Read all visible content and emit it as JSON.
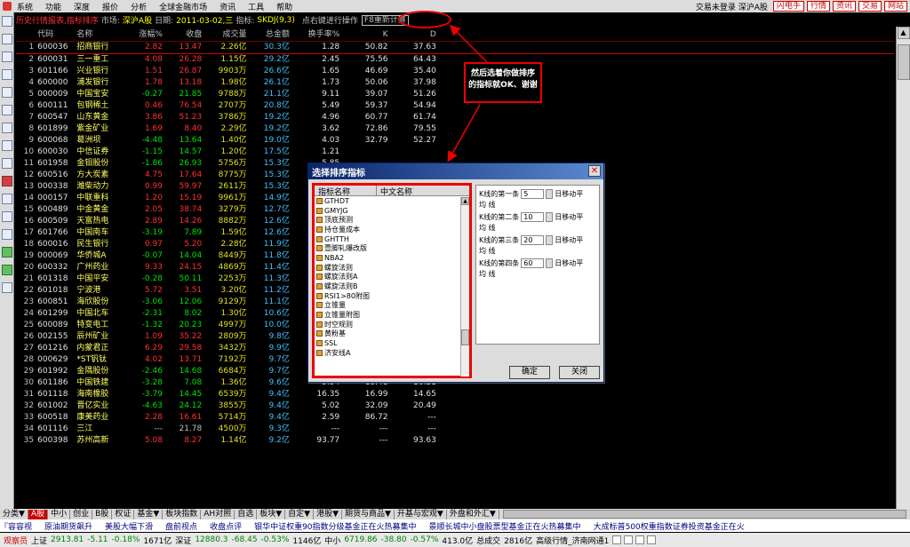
{
  "menu": {
    "items": [
      "系统",
      "功能",
      "深度",
      "报价",
      "分析",
      "全球金融市场",
      "资讯",
      "工具",
      "帮助"
    ],
    "login_status": "交易未登录 深沪A股",
    "buttons": [
      "闪电手",
      "行情",
      "资讯",
      "交易",
      "网站"
    ]
  },
  "titlebar": {
    "title": "历史行情报表,指标排序",
    "market_label": "市场:",
    "market_value": "深沪A股",
    "date_label": "日期:",
    "date_value": "2011-03-02,三",
    "indicator_label": "指标:",
    "indicator_value": "SKDJ(9,3)",
    "hint": "点右键进行操作",
    "recalc_button": "F8重新计算"
  },
  "table": {
    "columns": [
      "",
      "代码",
      "名称",
      "涨幅%",
      "收盘",
      "成交量",
      "总金额",
      "换手率%",
      "K",
      "D"
    ],
    "rows": [
      {
        "i": "1",
        "code": "600036",
        "name": "招商银行",
        "chg": "2.82",
        "close": "13.47",
        "vol": "2.26亿",
        "amt": "30.3亿",
        "turn": "1.28",
        "k": "50.82",
        "d": "37.63"
      },
      {
        "i": "2",
        "code": "600031",
        "name": "三一重工",
        "chg": "4.08",
        "close": "26.28",
        "vol": "1.15亿",
        "amt": "29.2亿",
        "turn": "2.45",
        "k": "75.56",
        "d": "64.43"
      },
      {
        "i": "3",
        "code": "601166",
        "name": "兴业银行",
        "chg": "1.51",
        "close": "26.87",
        "vol": "9903万",
        "amt": "26.6亿",
        "turn": "1.65",
        "k": "46.69",
        "d": "35.40"
      },
      {
        "i": "4",
        "code": "600000",
        "name": "浦发银行",
        "chg": "1.78",
        "close": "13.18",
        "vol": "1.98亿",
        "amt": "26.1亿",
        "turn": "1.73",
        "k": "50.06",
        "d": "37.98"
      },
      {
        "i": "5",
        "code": "000009",
        "name": "中国宝安",
        "chg": "-0.27",
        "close": "21.85",
        "vol": "9788万",
        "amt": "21.1亿",
        "turn": "9.11",
        "k": "39.07",
        "d": "51.26"
      },
      {
        "i": "6",
        "code": "600111",
        "name": "包钢稀土",
        "chg": "0.46",
        "close": "76.54",
        "vol": "2707万",
        "amt": "20.8亿",
        "turn": "5.49",
        "k": "59.37",
        "d": "54.94"
      },
      {
        "i": "7",
        "code": "600547",
        "name": "山东黄金",
        "chg": "3.86",
        "close": "51.23",
        "vol": "3786万",
        "amt": "19.2亿",
        "turn": "4.96",
        "k": "60.77",
        "d": "61.74"
      },
      {
        "i": "8",
        "code": "601899",
        "name": "紫金矿业",
        "chg": "1.69",
        "close": "8.40",
        "vol": "2.29亿",
        "amt": "19.2亿",
        "turn": "3.62",
        "k": "72.86",
        "d": "79.55"
      },
      {
        "i": "9",
        "code": "600068",
        "name": "葛洲坝",
        "chg": "-4.48",
        "close": "13.64",
        "vol": "1.40亿",
        "amt": "19.0亿",
        "turn": "4.03",
        "k": "32.79",
        "d": "52.27"
      },
      {
        "i": "10",
        "code": "600030",
        "name": "中信证券",
        "chg": "-1.15",
        "close": "14.57",
        "vol": "1.20亿",
        "amt": "17.5亿",
        "turn": "1.21",
        "k": "",
        "d": ""
      },
      {
        "i": "11",
        "code": "601958",
        "name": "金钼股份",
        "chg": "-1.86",
        "close": "26.93",
        "vol": "5756万",
        "amt": "15.3亿",
        "turn": "5.85",
        "k": "",
        "d": ""
      },
      {
        "i": "12",
        "code": "600516",
        "name": "方大炭素",
        "chg": "4.75",
        "close": "17.64",
        "vol": "8775万",
        "amt": "15.3亿",
        "turn": "14.2",
        "k": "",
        "d": ""
      },
      {
        "i": "13",
        "code": "000338",
        "name": "潍柴动力",
        "chg": "0.99",
        "close": "59.97",
        "vol": "2611万",
        "amt": "15.3亿",
        "turn": "3.9",
        "k": "",
        "d": ""
      },
      {
        "i": "14",
        "code": "000157",
        "name": "中联重科",
        "chg": "1.20",
        "close": "15.19",
        "vol": "9961万",
        "amt": "14.9亿",
        "turn": "2.0",
        "k": "",
        "d": ""
      },
      {
        "i": "15",
        "code": "600489",
        "name": "中金黄金",
        "chg": "2.05",
        "close": "38.74",
        "vol": "3279万",
        "amt": "12.7亿",
        "turn": "2.3",
        "k": "",
        "d": ""
      },
      {
        "i": "16",
        "code": "600509",
        "name": "天富热电",
        "chg": "2.89",
        "close": "14.26",
        "vol": "8882万",
        "amt": "12.6亿",
        "turn": "13.5",
        "k": "",
        "d": ""
      },
      {
        "i": "17",
        "code": "601766",
        "name": "中国南车",
        "chg": "-3.19",
        "close": "7.89",
        "vol": "1.59亿",
        "amt": "12.6亿",
        "turn": "1.6",
        "k": "",
        "d": ""
      },
      {
        "i": "18",
        "code": "600016",
        "name": "民生银行",
        "chg": "0.97",
        "close": "5.20",
        "vol": "2.28亿",
        "amt": "11.9亿",
        "turn": "1.0",
        "k": "",
        "d": ""
      },
      {
        "i": "19",
        "code": "000069",
        "name": "华侨城A",
        "chg": "-0.07",
        "close": "14.04",
        "vol": "8449万",
        "amt": "11.8亿",
        "turn": "2.9",
        "k": "",
        "d": ""
      },
      {
        "i": "20",
        "code": "600332",
        "name": "广州药业",
        "chg": "9.33",
        "close": "24.15",
        "vol": "4869万",
        "amt": "11.4亿",
        "turn": "9.7",
        "k": "",
        "d": ""
      },
      {
        "i": "21",
        "code": "601318",
        "name": "中国平安",
        "chg": "-0.28",
        "close": "50.11",
        "vol": "2253万",
        "amt": "11.3亿",
        "turn": "0.4",
        "k": "",
        "d": ""
      },
      {
        "i": "22",
        "code": "601018",
        "name": "宁波港",
        "chg": "5.72",
        "close": "3.51",
        "vol": "3.20亿",
        "amt": "11.2亿",
        "turn": "10.2",
        "k": "",
        "d": ""
      },
      {
        "i": "23",
        "code": "600851",
        "name": "海欣股份",
        "chg": "-3.06",
        "close": "12.06",
        "vol": "9129万",
        "amt": "11.1亿",
        "turn": "12.5",
        "k": "",
        "d": ""
      },
      {
        "i": "24",
        "code": "601299",
        "name": "中国北车",
        "chg": "-2.31",
        "close": "8.02",
        "vol": "1.30亿",
        "amt": "10.6亿",
        "turn": "1.3",
        "k": "",
        "d": ""
      },
      {
        "i": "25",
        "code": "600089",
        "name": "特变电工",
        "chg": "-1.32",
        "close": "20.23",
        "vol": "4997万",
        "amt": "10.0亿",
        "turn": "2.2",
        "k": "",
        "d": ""
      },
      {
        "i": "26",
        "code": "002155",
        "name": "辰州矿业",
        "chg": "1.09",
        "close": "35.22",
        "vol": "2809万",
        "amt": "9.8亿",
        "turn": "8.7",
        "k": "",
        "d": ""
      },
      {
        "i": "27",
        "code": "601216",
        "name": "内蒙君正",
        "chg": "6.29",
        "close": "29.58",
        "vol": "3432万",
        "amt": "9.9亿",
        "turn": "35.75",
        "k": "69.36",
        "d": "64.83"
      },
      {
        "i": "28",
        "code": "000629",
        "name": "*ST钒钛",
        "chg": "4.02",
        "close": "13.71",
        "vol": "7192万",
        "amt": "9.7亿",
        "turn": "2.26",
        "k": "69.95",
        "d": "67.13"
      },
      {
        "i": "29",
        "code": "601992",
        "name": "金隅股份",
        "chg": "-2.46",
        "close": "14.68",
        "vol": "6684万",
        "amt": "9.7亿",
        "turn": "21.15",
        "k": "30.24",
        "d": "---"
      },
      {
        "i": "30",
        "code": "601186",
        "name": "中国铁建",
        "chg": "-3.28",
        "close": "7.08",
        "vol": "1.36亿",
        "amt": "9.6亿",
        "turn": "5.54",
        "k": "13.41",
        "d": "16.21"
      },
      {
        "i": "31",
        "code": "601118",
        "name": "海南橡胶",
        "chg": "-3.79",
        "close": "14.45",
        "vol": "6539万",
        "amt": "9.4亿",
        "turn": "16.35",
        "k": "16.99",
        "d": "14.65"
      },
      {
        "i": "32",
        "code": "601002",
        "name": "晋亿实业",
        "chg": "-4.63",
        "close": "24.12",
        "vol": "3855万",
        "amt": "9.4亿",
        "turn": "5.02",
        "k": "32.09",
        "d": "20.49"
      },
      {
        "i": "33",
        "code": "600518",
        "name": "康美药业",
        "chg": "2.28",
        "close": "16.61",
        "vol": "5714万",
        "amt": "9.4亿",
        "turn": "2.59",
        "k": "86.72",
        "d": "---"
      },
      {
        "i": "34",
        "code": "601116",
        "name": "三江",
        "chg": "---",
        "close": "21.78",
        "vol": "4500万",
        "amt": "9.3亿",
        "turn": "---",
        "k": "---",
        "d": "---"
      },
      {
        "i": "35",
        "code": "600398",
        "name": "苏州高新",
        "chg": "5.08",
        "close": "8.27",
        "vol": "1.14亿",
        "amt": "9.2亿",
        "turn": "93.77",
        "k": "---",
        "d": "93.63"
      }
    ]
  },
  "annotation": {
    "text": "然后选着你做排序的指标就OK、谢谢"
  },
  "dialog": {
    "title": "选择排序指标",
    "col1": "指标名称",
    "col2": "中文名称",
    "items": [
      "GTHDT",
      "GMYJG",
      "顶底预测",
      "持仓量成本",
      "GHTTH",
      "壹脚轧爆改版",
      "NBA2",
      "螺旋法则",
      "螺旋法则A",
      "螺旋法则B",
      "RSI1>80附图",
      "立锥量",
      "立锥量附图",
      "时空规则",
      "黄粉基",
      "SSL",
      "济安线A"
    ],
    "ma_rows": [
      {
        "prefix": "K线的第一条",
        "value": "5",
        "suffix": "日移动平"
      },
      {
        "prefix": "K线的第二条",
        "value": "10",
        "suffix": "日移动平"
      },
      {
        "prefix": "K线的第三条",
        "value": "20",
        "suffix": "日移动平"
      },
      {
        "prefix": "K线的第四条",
        "value": "60",
        "suffix": "日移动平"
      }
    ],
    "line_word": "均 线",
    "ok_label": "确定",
    "close_label": "关闭",
    "close_x": "✕"
  },
  "tabs": [
    "分类▼",
    "A股",
    "中小",
    "创业",
    "B股",
    "权证",
    "基金▼",
    "板块指数",
    "AH对照",
    "自选",
    "板块▼",
    "自定▼",
    "港股▼",
    "期货与商品▼",
    "开基与宏观▼",
    "外盘和外汇▼"
  ],
  "ticker": [
    "『容容视",
    "原油期货飙升",
    "美股大幅下滑",
    "盘前视点",
    "收盘点评",
    "银华中证权重90指数分级基金正在火热募集中",
    "景顺长城中小盘股票型基金正在火热募集中",
    "大成标普500权重指数证券投资基金正在火"
  ],
  "status": {
    "brand": "观察员",
    "sh_label": "上证",
    "sh_value": "2913.81",
    "sh_chg": "-5.11",
    "sh_pct": "-0.18%",
    "sh_amt": "1671亿",
    "sz_label": "深证",
    "sz_value": "12880.3",
    "sz_chg": "-68.45",
    "sz_pct": "-0.53%",
    "sz_amt": "1146亿",
    "zx_label": "中小",
    "zx_value": "6719.86",
    "zx_chg": "-38.80",
    "zx_pct": "-0.57%",
    "zx_amt": "413.0亿",
    "total": "总成交",
    "total_val": "2816亿",
    "server": "高级行情_济南网通1"
  },
  "colors": {
    "up": "#ff3030",
    "down": "#00e000",
    "accent": "#e00000"
  }
}
